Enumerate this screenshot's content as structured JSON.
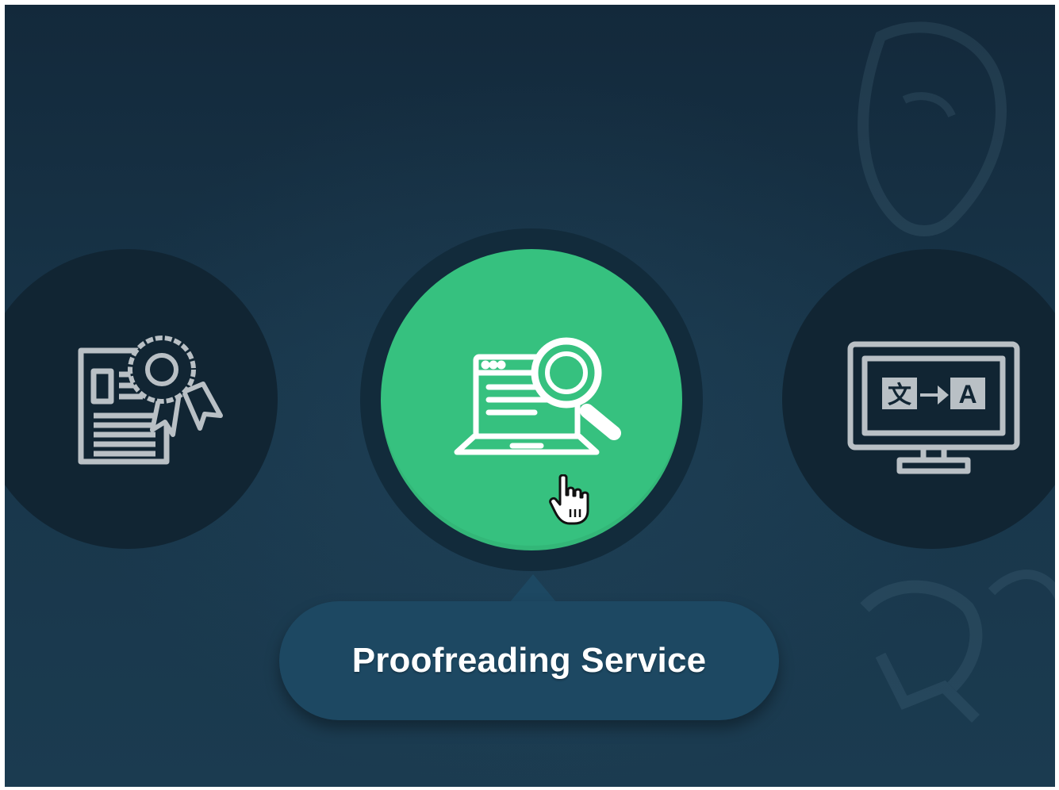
{
  "services": {
    "items": [
      {
        "id": "certified",
        "icon": "certificate-document-icon",
        "selected": false
      },
      {
        "id": "proofreading",
        "icon": "laptop-magnifier-icon",
        "selected": true
      },
      {
        "id": "translation",
        "icon": "monitor-translate-icon",
        "selected": false
      }
    ],
    "tooltip_label": "Proofreading Service",
    "translate_icon_glyphs": {
      "source": "文",
      "target": "A"
    }
  },
  "colors": {
    "background": "#183549",
    "circle_inactive": "#112533",
    "circle_active": "#36c17f",
    "tooltip": "#1d4862",
    "icon_inactive": "#b9c0c5",
    "icon_active": "#ffffff"
  },
  "cursor": {
    "type": "pointer-hand-icon"
  }
}
